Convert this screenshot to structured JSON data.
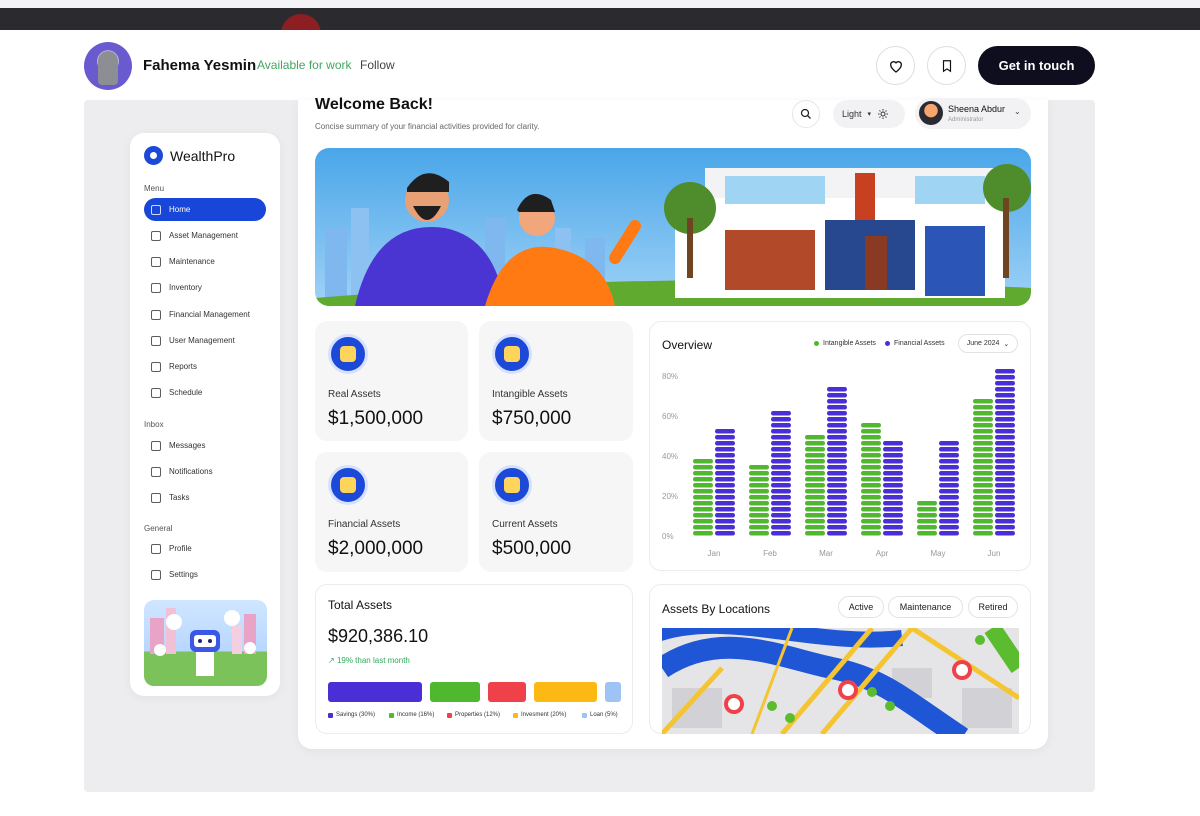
{
  "profile": {
    "name": "Fahema Yesmin",
    "availability": "Available for work",
    "follow_label": "Follow",
    "contact_label": "Get in touch",
    "like_icon": "heart-icon",
    "save_icon": "bookmark-icon"
  },
  "app": {
    "brand": "WealthPro",
    "sections": {
      "menu": "Menu",
      "inbox": "Inbox",
      "general": "General"
    },
    "menu_items": [
      {
        "label": "Home",
        "icon": "grid-icon",
        "active": true
      },
      {
        "label": "Asset Management",
        "icon": "database-icon"
      },
      {
        "label": "Maintenance",
        "icon": "tools-icon"
      },
      {
        "label": "Inventory",
        "icon": "box-icon"
      },
      {
        "label": "Financial Management",
        "icon": "money-icon"
      },
      {
        "label": "User Management",
        "icon": "users-icon"
      },
      {
        "label": "Reports",
        "icon": "report-icon"
      },
      {
        "label": "Schedule",
        "icon": "calendar-icon"
      }
    ],
    "inbox_items": [
      {
        "label": "Messages",
        "icon": "mail-icon"
      },
      {
        "label": "Notifications",
        "icon": "bell-icon"
      },
      {
        "label": "Tasks",
        "icon": "task-icon"
      }
    ],
    "general_items": [
      {
        "label": "Profile",
        "icon": "user-icon"
      },
      {
        "label": "Settings",
        "icon": "gear-icon"
      }
    ]
  },
  "header": {
    "title": "Welcome Back!",
    "subtitle": "Concise summary of your financial activities provided for clarity.",
    "theme_label": "Light",
    "user_name": "Sheena Abdur",
    "user_role": "Administrator"
  },
  "assets": [
    {
      "label": "Real Assets",
      "value": "$1,500,000"
    },
    {
      "label": "Intangible Assets",
      "value": "$750,000"
    },
    {
      "label": "Financial Assets",
      "value": "$2,000,000"
    },
    {
      "label": "Current Assets",
      "value": "$500,000"
    }
  ],
  "chart_data": {
    "type": "bar",
    "title": "Overview",
    "categories": [
      "Jan",
      "Feb",
      "Mar",
      "Apr",
      "May",
      "Jun"
    ],
    "series": [
      {
        "name": "Intangible Assets",
        "color": "#4fb82f",
        "values": [
          39,
          36,
          52,
          58,
          19,
          68
        ]
      },
      {
        "name": "Financial Assets",
        "color": "#4a2fd6",
        "values": [
          55,
          62,
          75,
          48,
          48,
          85
        ]
      }
    ],
    "yticks": [
      "80%",
      "60%",
      "40%",
      "20%",
      "0%"
    ],
    "ylim": [
      0,
      80
    ],
    "legend_position": "top-right",
    "period_label": "June 2024"
  },
  "total_assets": {
    "title": "Total Assets",
    "value": "$920,386.10",
    "trend": "19% than last month",
    "breakdown": [
      {
        "label": "Savings (30%)",
        "color": "#4a2fd6",
        "percent": 30
      },
      {
        "label": "Income (16%)",
        "color": "#4fb82f",
        "percent": 16
      },
      {
        "label": "Properties (12%)",
        "color": "#f0404a",
        "percent": 12
      },
      {
        "label": "Invesment (20%)",
        "color": "#fdb913",
        "percent": 20
      },
      {
        "label": "Loan (5%)",
        "color": "#9ec3f5",
        "percent": 5
      }
    ]
  },
  "locations": {
    "title": "Assets By Locations",
    "filters": [
      "Active",
      "Maintenance",
      "Retired"
    ]
  }
}
